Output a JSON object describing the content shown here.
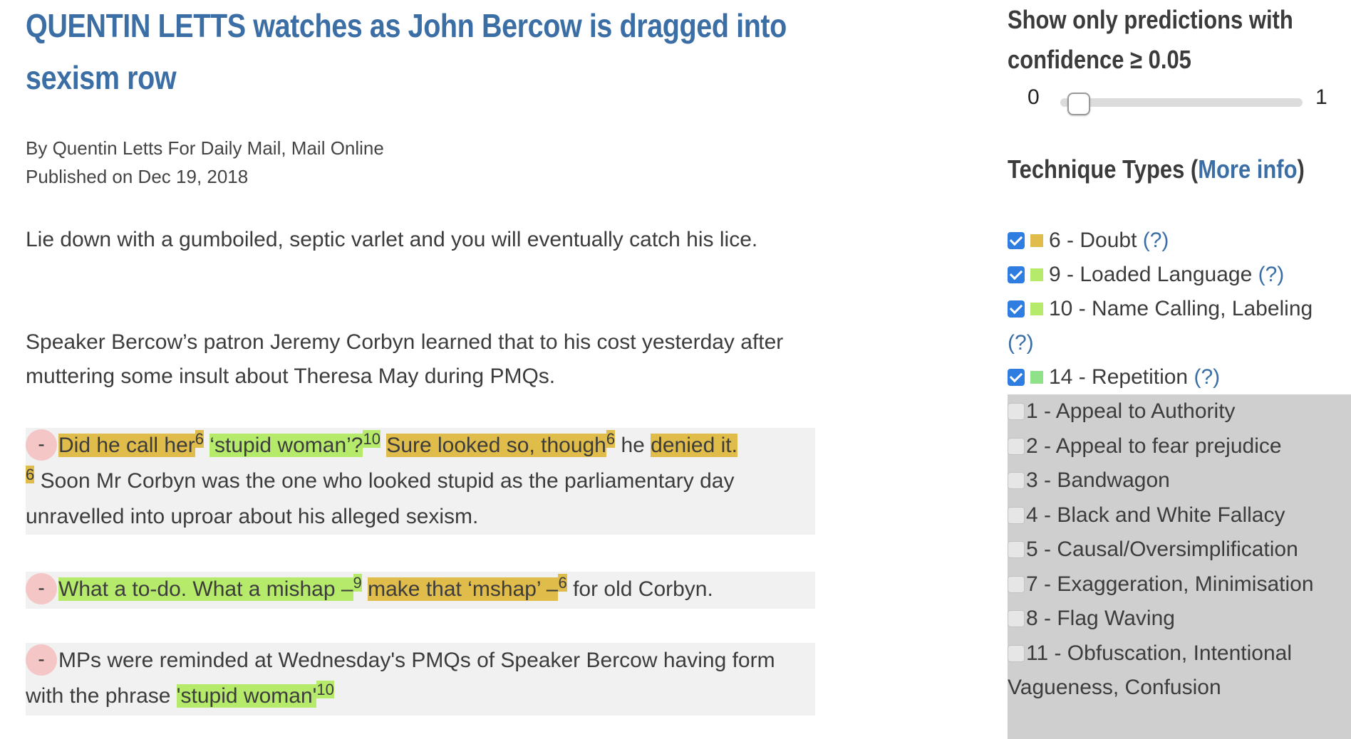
{
  "article": {
    "headline": "QUENTIN LETTS watches as John Bercow is dragged into sexism row",
    "byline": "By Quentin Letts For Daily Mail, Mail Online",
    "published": "Published on Dec 19, 2018",
    "p1": "Lie down with a gumboiled, septic varlet and you will eventually catch his lice.",
    "p2": "Speaker Bercow’s patron Jeremy Corbyn learned that to his cost yesterday after muttering some insult about Theresa May during PMQs.",
    "blocks": [
      {
        "dash": "-",
        "s1": "Did he call her",
        "s1n": "6",
        "s2": "‘stupid woman’?",
        "s2n": "10",
        "s3": "Sure looked so, though",
        "s3n": "6",
        "s4": " he ",
        "s5": "denied it.",
        "s5n": "6",
        "s6": " Soon Mr Corbyn was the one who looked stupid as the parliamentary day unravelled into uproar about his alleged sexism."
      },
      {
        "dash": "-",
        "s1": "What a to-do. What a mishap –",
        "s1n": "9",
        "s2": "make that ‘mshap’ –",
        "s2n": "6",
        "s3": " for old Corbyn."
      },
      {
        "dash": "-",
        "s1": "MPs were reminded at Wednesday's PMQs of Speaker Bercow having form with the phrase ",
        "s2": "'stupid woman'",
        "s2n": "10"
      }
    ]
  },
  "sidebar": {
    "filter_title": "Show only predictions with confidence ≥ 0.05",
    "slider_min": "0",
    "slider_max": "1",
    "slider_value": 0.05,
    "types_title": "Technique Types (",
    "types_link": "More info",
    "types_close": ")",
    "help": "(?)",
    "checked": [
      {
        "label": "6 - Doubt",
        "color": "#e0bd4a"
      },
      {
        "label": "9 - Loaded Language",
        "color": "#b5ea6b"
      },
      {
        "label": "10 - Name Calling, Labeling",
        "color": "#b5ea6b"
      },
      {
        "label": "14 - Repetition",
        "color": "#8fe28a"
      }
    ],
    "unchecked": [
      "1 - Appeal to Authority",
      "2 - Appeal to fear prejudice",
      "3 - Bandwagon",
      "4 - Black and White Fallacy",
      "5 - Causal/Oversimplification",
      "7 - Exaggeration, Minimisation",
      "8 - Flag Waving",
      "11 - Obfuscation, Intentional Vagueness, Confusion"
    ]
  },
  "colors": {
    "link": "#3b6ea5",
    "doubt": "#e0bd4a",
    "loaded": "#b5ea6b",
    "checkbox": "#2f7de1",
    "dash_bg": "#f4c6c6"
  }
}
